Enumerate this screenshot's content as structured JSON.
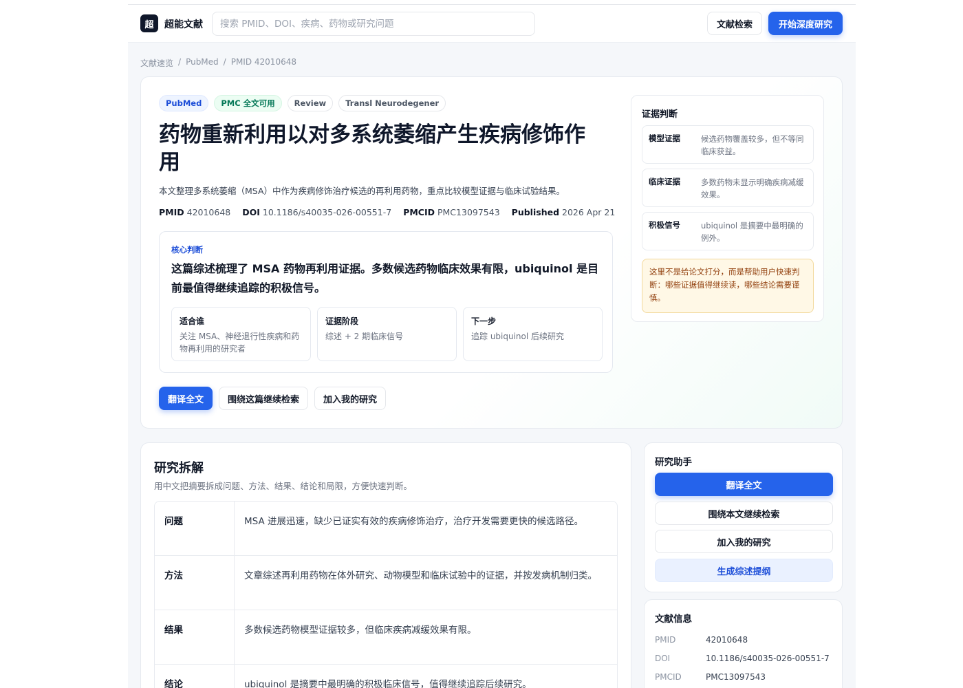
{
  "brand": {
    "logo_char": "超",
    "name": "超能文献"
  },
  "search": {
    "placeholder": "搜索 PMID、DOI、疾病、药物或研究问题"
  },
  "nav": {
    "literature_search": "文献检索",
    "start_deep_research": "开始深度研究"
  },
  "breadcrumb": [
    "文献速览",
    "PubMed",
    "PMID 42010648"
  ],
  "breadcrumb_sep": "/",
  "tags": [
    "PubMed",
    "PMC 全文可用",
    "Review",
    "Transl Neurodegener"
  ],
  "title": "药物重新利用以对多系统萎缩产生疾病修饰作用",
  "summary": "本文整理多系统萎缩（MSA）中作为疾病修饰治疗候选的再利用药物，重点比较模型证据与临床试验结果。",
  "meta": {
    "pmid_label": "PMID",
    "pmid": "42010648",
    "doi_label": "DOI",
    "doi": "10.1186/s40035-026-00551-7",
    "pmcid_label": "PMCID",
    "pmcid": "PMC13097543",
    "published_label": "Published",
    "published": "2026 Apr 21"
  },
  "core": {
    "label": "核心判断",
    "text": "这篇综述梳理了 MSA 药物再利用证据。多数候选药物临床效果有限，ubiquinol 是目前最值得继续追踪的积极信号。",
    "cards": [
      {
        "heading": "适合谁",
        "text": "关注 MSA、神经退行性疾病和药物再利用的研究者"
      },
      {
        "heading": "证据阶段",
        "text": "综述 + 2 期临床信号"
      },
      {
        "heading": "下一步",
        "text": "追踪 ubiquinol 后续研究"
      }
    ]
  },
  "actions": {
    "translate": "翻译全文",
    "search_around": "围绕这篇继续检索",
    "add_research": "加入我的研究"
  },
  "evidence": {
    "title": "证据判断",
    "rows": [
      {
        "key": "模型证据",
        "value": "候选药物覆盖较多，但不等同临床获益。"
      },
      {
        "key": "临床证据",
        "value": "多数药物未显示明确疾病减缓效果。"
      },
      {
        "key": "积极信号",
        "value": "ubiquinol 是摘要中最明确的例外。"
      }
    ],
    "note": "这里不是给论文打分，而是帮助用户快速判断：哪些证据值得继续读，哪些结论需要谨慎。"
  },
  "breakdown": {
    "title": "研究拆解",
    "subtitle": "用中文把摘要拆成问题、方法、结果、结论和局限，方便快速判断。",
    "rows": [
      {
        "key": "问题",
        "value": "MSA 进展迅速，缺少已证实有效的疾病修饰治疗，治疗开发需要更快的候选路径。"
      },
      {
        "key": "方法",
        "value": "文章综述再利用药物在体外研究、动物模型和临床试验中的证据，并按发病机制归类。"
      },
      {
        "key": "结果",
        "value": "多数候选药物模型证据较多，但临床疾病减缓效果有限。"
      },
      {
        "key": "结论",
        "value": "ubiquinol 是摘要中最明确的积极临床信号，值得继续追踪后续研究。"
      }
    ]
  },
  "assistant": {
    "title": "研究助手",
    "translate": "翻译全文",
    "search_around": "围绕本文继续检索",
    "add_research": "加入我的研究",
    "generate_outline": "生成综述提纲"
  },
  "docinfo": {
    "title": "文献信息",
    "rows": [
      {
        "key": "PMID",
        "value": "42010648"
      },
      {
        "key": "DOI",
        "value": "10.1186/s40035-026-00551-7"
      },
      {
        "key": "PMCID",
        "value": "PMC13097543"
      }
    ]
  }
}
